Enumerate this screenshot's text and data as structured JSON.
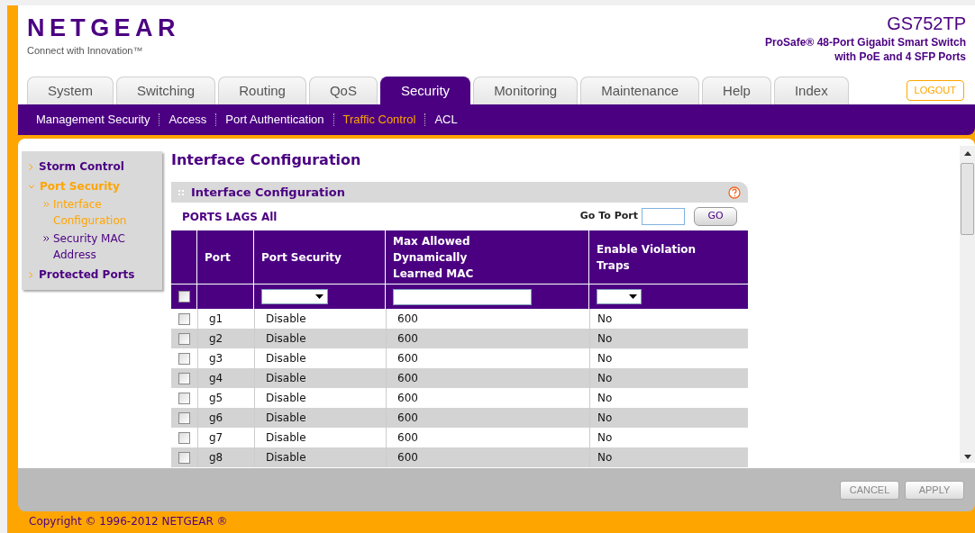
{
  "header": {
    "brand": "NETGEAR",
    "tagline": "Connect with Innovation™",
    "model": "GS752TP",
    "description_line_1": "ProSafe® 48-Port Gigabit Smart Switch",
    "description_line_2": "with PoE and 4 SFP Ports"
  },
  "tabs": [
    {
      "label": "System",
      "selected": false
    },
    {
      "label": "Switching",
      "selected": false
    },
    {
      "label": "Routing",
      "selected": false
    },
    {
      "label": "QoS",
      "selected": false
    },
    {
      "label": "Security",
      "selected": true
    },
    {
      "label": "Monitoring",
      "selected": false
    },
    {
      "label": "Maintenance",
      "selected": false
    },
    {
      "label": "Help",
      "selected": false
    },
    {
      "label": "Index",
      "selected": false
    }
  ],
  "logout_button": "LOGOUT",
  "subnav": [
    {
      "label": "Management Security",
      "selected": false
    },
    {
      "label": "Access",
      "selected": false
    },
    {
      "label": "Port Authentication",
      "selected": false
    },
    {
      "label": "Traffic Control",
      "selected": true
    },
    {
      "label": "ACL",
      "selected": false
    }
  ],
  "sidebar": {
    "items": [
      {
        "label": "Storm Control",
        "expanded": false,
        "selected": false
      },
      {
        "label": "Port Security",
        "expanded": true,
        "selected": true,
        "children": [
          {
            "label": "Interface Configuration",
            "selected": true
          },
          {
            "label": "Security MAC Address",
            "selected": false
          }
        ]
      },
      {
        "label": "Protected Ports",
        "expanded": false,
        "selected": false
      }
    ]
  },
  "page_title": "Interface Configuration",
  "panel": {
    "title": "Interface Configuration",
    "filters": [
      "PORTS",
      "LAGS",
      "All"
    ],
    "go_to_port_label": "Go To Port",
    "go_button": "GO",
    "table": {
      "columns": [
        "Port",
        "Port Security",
        "Max Allowed Dynamically Learned MAC",
        "Enable Violation Traps"
      ],
      "filter_row": {
        "checked": false
      },
      "rows": [
        {
          "checked": false,
          "port": "g1",
          "port_security": "Disable",
          "max_mac": "600",
          "violation_traps": "No"
        },
        {
          "checked": false,
          "port": "g2",
          "port_security": "Disable",
          "max_mac": "600",
          "violation_traps": "No"
        },
        {
          "checked": false,
          "port": "g3",
          "port_security": "Disable",
          "max_mac": "600",
          "violation_traps": "No"
        },
        {
          "checked": false,
          "port": "g4",
          "port_security": "Disable",
          "max_mac": "600",
          "violation_traps": "No"
        },
        {
          "checked": false,
          "port": "g5",
          "port_security": "Disable",
          "max_mac": "600",
          "violation_traps": "No"
        },
        {
          "checked": false,
          "port": "g6",
          "port_security": "Disable",
          "max_mac": "600",
          "violation_traps": "No"
        },
        {
          "checked": false,
          "port": "g7",
          "port_security": "Disable",
          "max_mac": "600",
          "violation_traps": "No"
        },
        {
          "checked": false,
          "port": "g8",
          "port_security": "Disable",
          "max_mac": "600",
          "violation_traps": "No"
        }
      ]
    }
  },
  "buttons": [
    "CANCEL",
    "APPLY"
  ],
  "copyright": "Copyright © 1996-2012 NETGEAR ®"
}
